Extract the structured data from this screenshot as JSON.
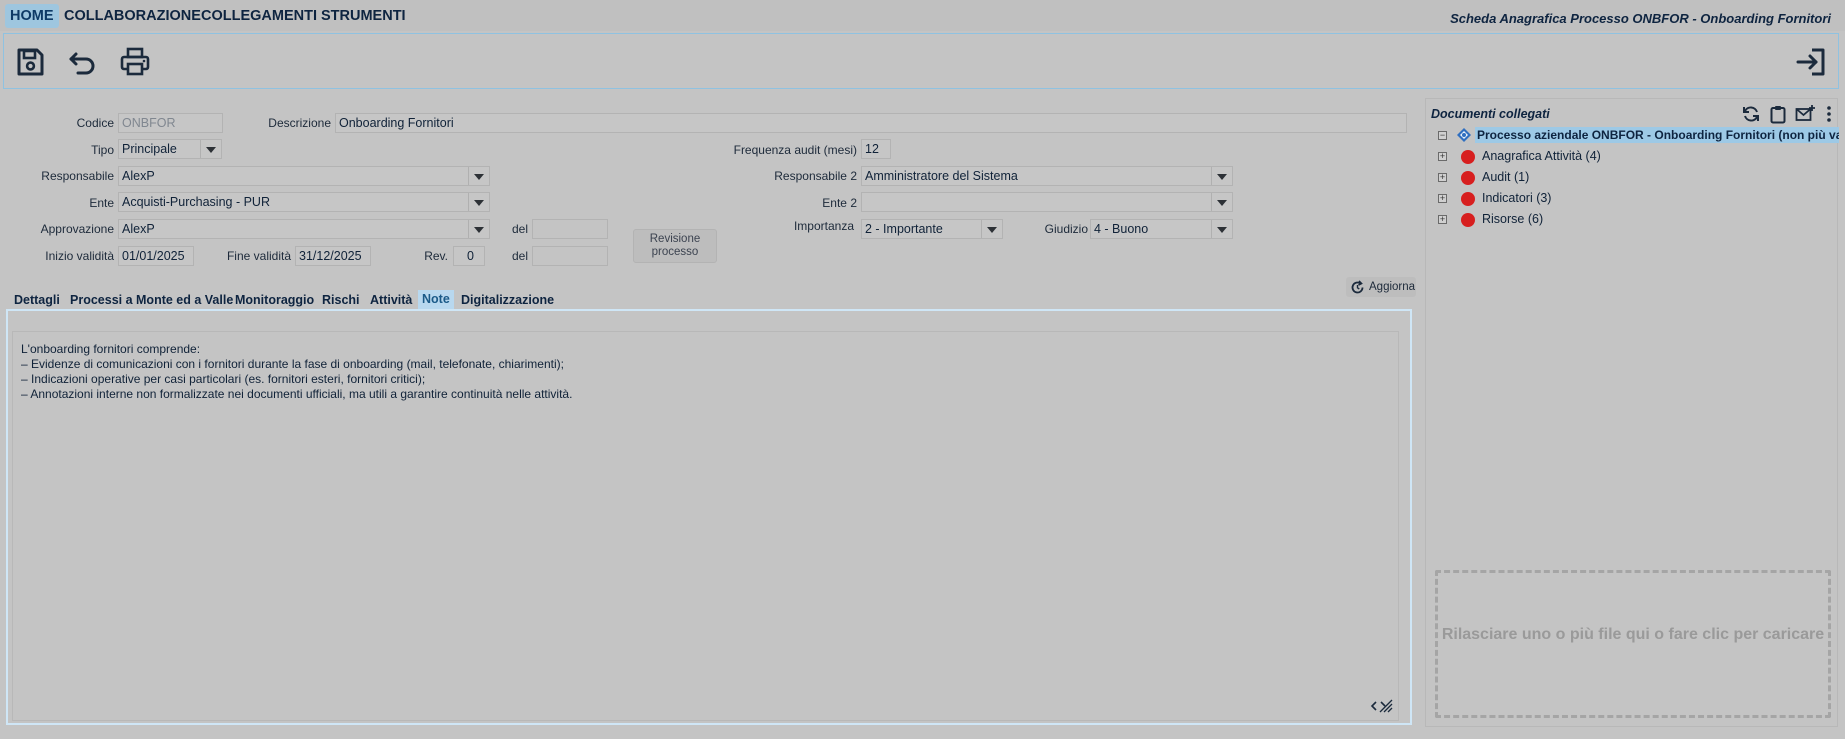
{
  "menu": {
    "items": [
      "HOME",
      "COLLABORAZIONE",
      "COLLEGAMENTI",
      "STRUMENTI"
    ],
    "window_title": "Scheda Anagrafica Processo ONBFOR - Onboarding Fornitori"
  },
  "toolbar": {
    "icons": [
      "save-icon",
      "undo-icon",
      "print-icon",
      "exit-icon"
    ]
  },
  "form": {
    "codice_label": "Codice",
    "codice_value": "ONBFOR",
    "descrizione_label": "Descrizione",
    "descrizione_value": "Onboarding Fornitori",
    "tipo_label": "Tipo",
    "tipo_value": "Principale",
    "frequenza_label": "Frequenza audit (mesi)",
    "frequenza_value": "12",
    "responsabile_label": "Responsabile",
    "responsabile_value": "AlexP",
    "responsabile2_label": "Responsabile 2",
    "responsabile2_value": "Amministratore del Sistema",
    "ente_label": "Ente",
    "ente_value": "Acquisti-Purchasing - PUR",
    "ente2_label": "Ente 2",
    "ente2_value": "",
    "approvazione_label": "Approvazione",
    "approvazione_value": "AlexP",
    "del_label": "del",
    "del1_value": "",
    "importanza_label": "Importanza",
    "importanza_value": "2 - Importante",
    "giudizio_label": "Giudizio",
    "giudizio_value": "4 - Buono",
    "inizio_label": "Inizio validità",
    "inizio_value": "01/01/2025",
    "fine_label": "Fine validità",
    "fine_value": "31/12/2025",
    "rev_label": "Rev.",
    "rev_value": "0",
    "del2_value": "",
    "revisione_button": "Revisione processo"
  },
  "aggiorna_button": "Aggiorna",
  "tabs": [
    {
      "label": "Dettagli",
      "active": false
    },
    {
      "label": "Processi a Monte ed a Valle",
      "active": false
    },
    {
      "label": "Monitoraggio",
      "active": false
    },
    {
      "label": "Rischi",
      "active": false
    },
    {
      "label": "Attività",
      "active": false
    },
    {
      "label": "Note",
      "active": true
    },
    {
      "label": "Digitalizzazione",
      "active": false
    }
  ],
  "notes": {
    "lines": [
      "L'onboarding fornitori comprende:",
      "– Evidenze di comunicazioni con i fornitori durante la fase di onboarding (mail, telefonate, chiarimenti);",
      "– Indicazioni operative per casi particolari (es. fornitori esteri, fornitori critici);",
      "– Annotazioni interne non formalizzate nei documenti ufficiali, ma utili a garantire continuità nelle attività."
    ]
  },
  "docs": {
    "title": "Documenti collegati",
    "icons": [
      "refresh-icon",
      "clipboard-icon",
      "mail-add-icon",
      "more-icon"
    ],
    "root_label": "Processo aziendale ONBFOR - Onboarding Fornitori (non più valido d",
    "nodes": [
      {
        "label": "Anagrafica Attività (4)"
      },
      {
        "label": "Audit (1)"
      },
      {
        "label": "Indicatori (3)"
      },
      {
        "label": "Risorse (6)"
      }
    ],
    "status_color": "#d71f1f",
    "dropzone_text": "Rilasciare uno o più file qui o fare clic per caricare"
  },
  "colors": {
    "accent": "#9ec6df",
    "background": "#c4c4c4",
    "tab_active": "#b8d8ef"
  }
}
